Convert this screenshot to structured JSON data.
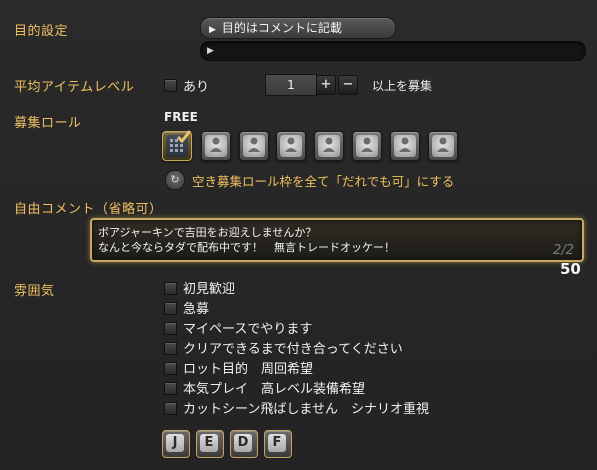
{
  "purpose": {
    "label": "目的設定",
    "value": "目的はコメントに記載",
    "sub_value": ""
  },
  "item_level": {
    "label": "平均アイテムレベル",
    "checkbox_label": "あり",
    "value": "1",
    "plus": "+",
    "minus": "−",
    "suffix": "以上を募集"
  },
  "roles": {
    "label": "募集ロール",
    "free_label": "FREE",
    "slot_count": 8,
    "reset_label": "空き募集ロール枠を全て「だれでも可」にする"
  },
  "comment": {
    "label": "自由コメント（省略可）",
    "line1": "ボアジャーキンで吉田をお迎えしませんか？",
    "line2": "なんと今ならタダで配布中です！　無言トレードオッケー！",
    "page": "2/2",
    "remaining": "50"
  },
  "atmosphere": {
    "label": "雰囲気",
    "options": [
      "初見歓迎",
      "急募",
      "マイペースでやります",
      "クリアできるまで付き合ってください",
      "ロット目的　周回希望",
      "本気プレイ　高レベル装備希望",
      "カットシーン飛ばしません　シナリオ重視"
    ]
  },
  "languages": [
    "J",
    "E",
    "D",
    "F"
  ]
}
